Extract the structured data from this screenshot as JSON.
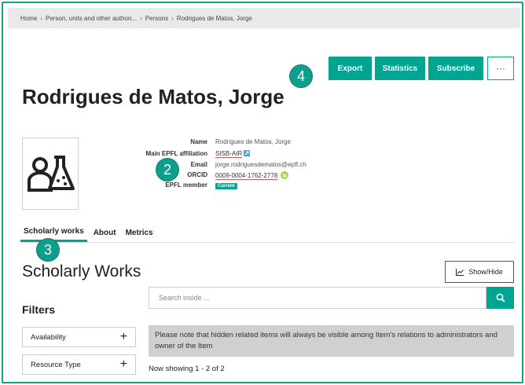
{
  "breadcrumb": [
    {
      "label": "Home"
    },
    {
      "label": "Person, units and other authori..."
    },
    {
      "label": "Persons"
    },
    {
      "label": "Rodrigues de Matos, Jorge"
    }
  ],
  "breadcrumb_sep": "›",
  "actions": {
    "export": "Export",
    "statistics": "Statistics",
    "subscribe": "Subscribe",
    "more": "···"
  },
  "badges": {
    "b4": "4",
    "b2": "2",
    "b3": "3"
  },
  "person": {
    "title": "Rodrigues de Matos, Jorge",
    "name_label": "Name",
    "name_value": "Rodrigues de Matos, Jorge",
    "affiliation_label": "Main EPFL affiliation",
    "affiliation_value": "SISB-AIR",
    "email_label": "Email",
    "email_value": "jorge.rodriguesdematos@epfl.ch",
    "orcid_label": "ORCID",
    "orcid_value": "0009-0004-1762-2778",
    "member_label": "EPFL member",
    "member_value": "Current"
  },
  "tabs": [
    {
      "label": "Scholarly works"
    },
    {
      "label": "About"
    },
    {
      "label": "Metrics"
    }
  ],
  "works": {
    "title": "Scholarly Works",
    "show_hide": "Show/Hide",
    "search_placeholder": "Search inside ...",
    "filters_title": "Filters",
    "filters": [
      {
        "label": "Availability"
      },
      {
        "label": "Resource Type"
      }
    ],
    "notice": "Please note that hidden related items will always be visible among Item's relations to administrators and owner of the Item",
    "showing": "Now showing 1 - 2 of 2"
  },
  "colors": {
    "accent": "#00a591",
    "badge": "#0f9d8f",
    "notice_bg": "#d0d0d0"
  }
}
